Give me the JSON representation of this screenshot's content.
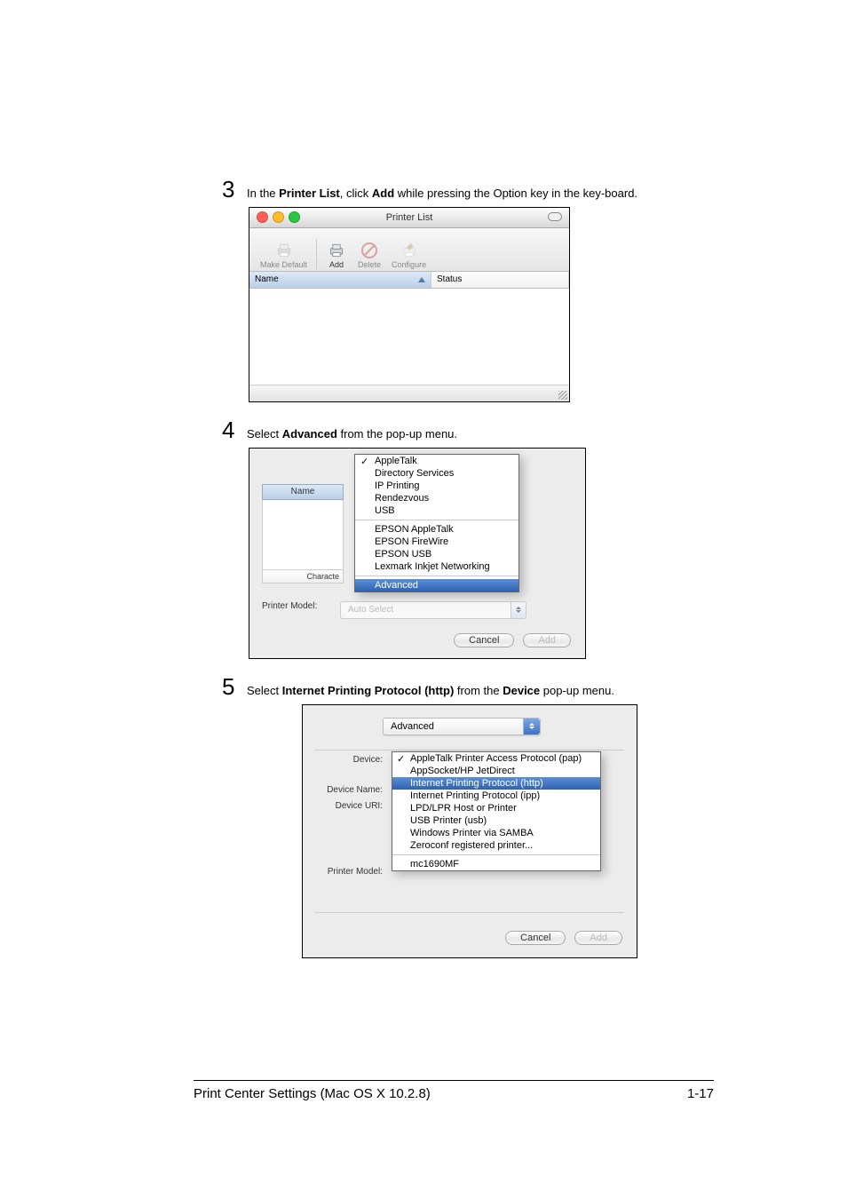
{
  "steps": {
    "s3": {
      "num": "3",
      "pre": "In the ",
      "b1": "Printer List",
      "mid": ", click ",
      "b2": "Add",
      "post": " while pressing the Option key in the key-board."
    },
    "s4": {
      "num": "4",
      "pre": "Select ",
      "b1": "Advanced",
      "post": " from the pop-up menu."
    },
    "s5": {
      "num": "5",
      "pre": "Select ",
      "b1": "Internet Printing Protocol (http)",
      "mid": " from the ",
      "b2": "Device",
      "post": " pop-up menu."
    }
  },
  "win1": {
    "title": "Printer List",
    "toolbar": {
      "make_default": "Make Default",
      "add": "Add",
      "delete": "Delete",
      "configure": "Configure"
    },
    "cols": {
      "name": "Name",
      "status": "Status"
    }
  },
  "win2": {
    "name_label": "Name",
    "char_label": "Characte",
    "pm_label": "Printer Model:",
    "auto": "Auto Select",
    "menu": [
      {
        "label": "AppleTalk",
        "checked": true
      },
      {
        "label": "Directory Services"
      },
      {
        "label": "IP Printing"
      },
      {
        "label": "Rendezvous"
      },
      {
        "label": "USB"
      },
      {
        "sep": true
      },
      {
        "label": "EPSON AppleTalk"
      },
      {
        "label": "EPSON FireWire"
      },
      {
        "label": "EPSON USB"
      },
      {
        "label": "Lexmark Inkjet Networking"
      },
      {
        "sep": true
      },
      {
        "label": "Advanced",
        "selected": true
      }
    ],
    "cancel": "Cancel",
    "add": "Add"
  },
  "win3": {
    "combo": "Advanced",
    "labels": {
      "device": "Device:",
      "device_name": "Device Name:",
      "device_uri": "Device URI:",
      "printer_model": "Printer Model:"
    },
    "menu": [
      {
        "label": "AppleTalk Printer Access Protocol (pap)",
        "checked": true
      },
      {
        "label": "AppSocket/HP JetDirect"
      },
      {
        "label": "Internet Printing Protocol (http)",
        "selected": true
      },
      {
        "label": "Internet Printing Protocol (ipp)"
      },
      {
        "label": "LPD/LPR Host or Printer"
      },
      {
        "label": "USB Printer (usb)"
      },
      {
        "label": "Windows Printer via SAMBA"
      },
      {
        "label": "Zeroconf registered printer..."
      },
      {
        "sep": true
      },
      {
        "label": "mc1690MF"
      }
    ],
    "cancel": "Cancel",
    "add": "Add"
  },
  "footer": {
    "left": "Print Center Settings (Mac OS X 10.2.8)",
    "right": "1-17"
  }
}
